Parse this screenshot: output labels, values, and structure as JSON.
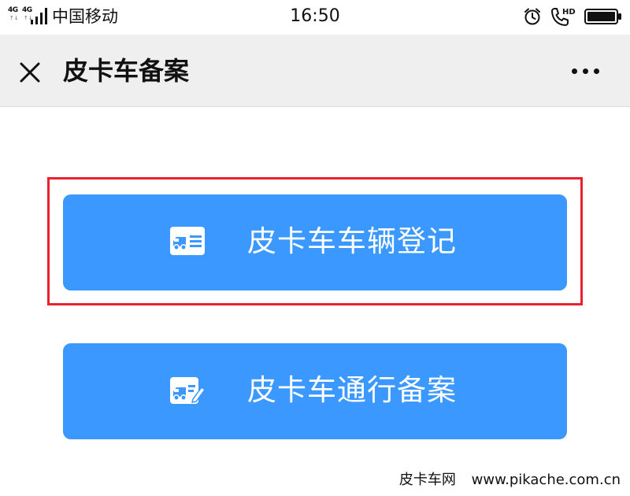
{
  "status_bar": {
    "network_badges": [
      "4G",
      "4G"
    ],
    "carrier": "中国移动",
    "time": "16:50",
    "call_badge": "HD"
  },
  "nav": {
    "title": "皮卡车备案",
    "close_icon": "close-icon",
    "more_icon": "more-dots-icon"
  },
  "actions": [
    {
      "label": "皮卡车车辆登记",
      "icon": "vehicle-card-icon",
      "highlighted": true
    },
    {
      "label": "皮卡车通行备案",
      "icon": "vehicle-edit-icon",
      "highlighted": false
    }
  ],
  "watermark": {
    "site_name": "皮卡车网",
    "url": "www.pikache.com.cn"
  },
  "colors": {
    "button_blue": "#3b98ff",
    "nav_bg": "#efefef",
    "highlight_red": "#e8212c"
  }
}
